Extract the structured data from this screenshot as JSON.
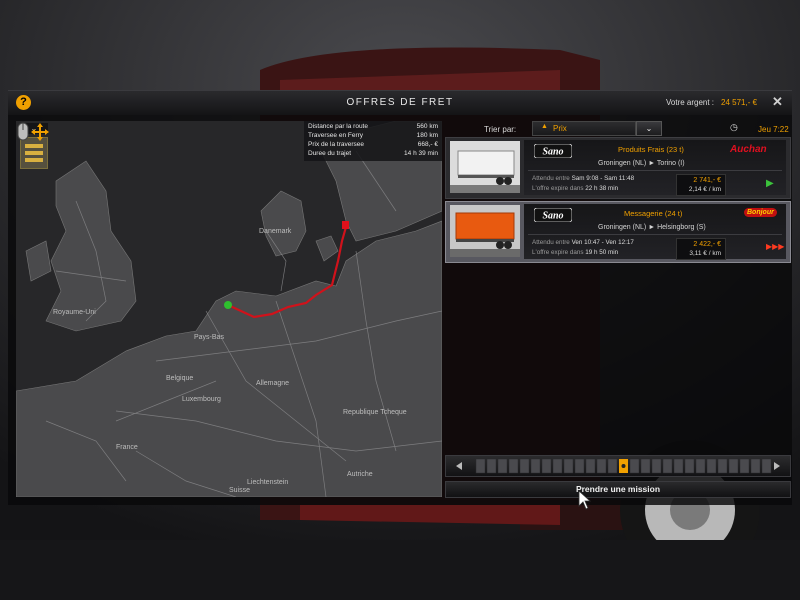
{
  "window": {
    "title": "OFFRES DE FRET",
    "money_label": "Votre argent :",
    "money_value": "24 571,- €",
    "help_icon": "?",
    "close_icon": "✕"
  },
  "map": {
    "collapse_icon": "chevron-down",
    "route_info": [
      {
        "label": "Distance par la route",
        "value": "560 km"
      },
      {
        "label": "Traversee en Ferry",
        "value": "180 km"
      },
      {
        "label": "Prix de la traversee",
        "value": "668,- €"
      },
      {
        "label": "Duree du trajet",
        "value": "14 h 39 min"
      }
    ],
    "countries": [
      "Danemark",
      "Royaume-Uni",
      "Pays-Bas",
      "Belgique",
      "Luxembourg",
      "Allemagne",
      "France",
      "Republique Tcheque",
      "Autriche",
      "Liechtenstein",
      "Suisse"
    ]
  },
  "filter": {
    "sort_label": "Trier par:",
    "sort_value": "Prix",
    "time": "Jeu 7:22"
  },
  "jobs": [
    {
      "company": "Sano",
      "cargo": "Produits Frais (23 t)",
      "route": "Groningen (NL) ► Torino (I)",
      "expected_label": "Attendu entre",
      "expected_value": "Sam 9:08 - Sam 11:48",
      "expires_label": "L'offre expire dans",
      "expires_value": "22 h 38 min",
      "price": "2 741,- €",
      "per_km": "2,14 € / km",
      "brand": "Auchan",
      "urgency": "▶",
      "selected": false
    },
    {
      "company": "Sano",
      "cargo": "Messagerie (24 t)",
      "route": "Groningen (NL) ► Helsingborg (S)",
      "expected_label": "Attendu entre",
      "expected_value": "Ven 10:47 - Ven 12:17",
      "expires_label": "L'offre expire dans",
      "expires_value": "19 h 50 min",
      "price": "2 422,- €",
      "per_km": "3,11 € / km",
      "brand": "Bonjour",
      "urgency": "▶▶▶",
      "selected": true
    }
  ],
  "take_mission": "Prendre une mission",
  "colors": {
    "accent": "#f0a000",
    "route": "#d0121b",
    "panel": "#2b2b2e"
  }
}
